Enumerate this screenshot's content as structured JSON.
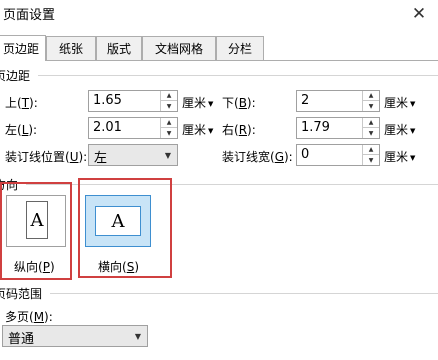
{
  "title": "页面设置",
  "close_glyph": "✕",
  "tabs": [
    {
      "label": "页边距",
      "active": true
    },
    {
      "label": "纸张",
      "active": false
    },
    {
      "label": "版式",
      "active": false
    },
    {
      "label": "文档网格",
      "active": false
    },
    {
      "label": "分栏",
      "active": false
    }
  ],
  "margins": {
    "section_label": "页边距",
    "top": {
      "label": "上(",
      "key": "T",
      "close": "):",
      "value": "1.65"
    },
    "bottom": {
      "label": "下(",
      "key": "B",
      "close": "):",
      "value": "2"
    },
    "left": {
      "label": "左(",
      "key": "L",
      "close": "):",
      "value": "2.01"
    },
    "right": {
      "label": "右(",
      "key": "R",
      "close": "):",
      "value": "1.79"
    },
    "gutter_pos": {
      "label": "装订线位置(",
      "key": "U",
      "close": "):",
      "value": "左"
    },
    "gutter_width": {
      "label": "装订线宽(",
      "key": "G",
      "close": "):",
      "value": "0"
    },
    "unit": "厘米"
  },
  "orientation": {
    "section_label": "方向",
    "portrait": {
      "label": "纵向(",
      "key": "P",
      "close": ")"
    },
    "landscape": {
      "label": "横向(",
      "key": "S",
      "close": ")"
    },
    "icon_letter": "A",
    "selected": "landscape",
    "highlight_color": "#d04040"
  },
  "pages": {
    "section_label": "页码范围",
    "multi_label": "多页(",
    "multi_key": "M",
    "multi_close": "):",
    "multi_value": "普通"
  }
}
